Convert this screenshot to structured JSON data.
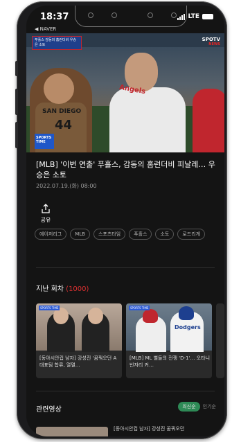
{
  "status": {
    "time": "18:37",
    "back_app": "◀ NAVER",
    "network": "LTE"
  },
  "video": {
    "overlay_badge": "푸홀스 감동의 홈런더비 우승은 소토",
    "channel_logo": "SPOTV",
    "channel_sub": "NEWS",
    "watermark": "SPORTS TIME",
    "jersey_text": "SAN DIEGO",
    "jersey_number": "44",
    "jersey2_text": "Angels"
  },
  "article": {
    "title": "[MLB] '이번 연출' 푸홀스, 감동의 홈런더비 피날레… 우승은 소토",
    "date": "2022.07.19.(화) 08:00",
    "share_label": "공유"
  },
  "tags": [
    "에이저리그",
    "MLB",
    "스포츠타임",
    "푸홀스",
    "소토",
    "로드리게"
  ],
  "previous": {
    "label": "지난 회차",
    "count": "(1000)",
    "cards": [
      {
        "caption": "[동아시안컵 남자] 강성진 '꿈꿔오던 A대표팀 합류, 열멸…",
        "mini": "SPORTS TIME"
      },
      {
        "caption": "[MLB] ML 별들의 전쟁 'D-1'… 오타니 빈자리 커…",
        "mini": "SPORTS TIME",
        "jersey": "Dodgers"
      }
    ]
  },
  "related": {
    "label": "관련영상",
    "sort_active": "최신순",
    "sort_inactive": "인기순",
    "bottom_caption": "[동아시안컵 남자] 강성진 꿈꿔오던"
  }
}
